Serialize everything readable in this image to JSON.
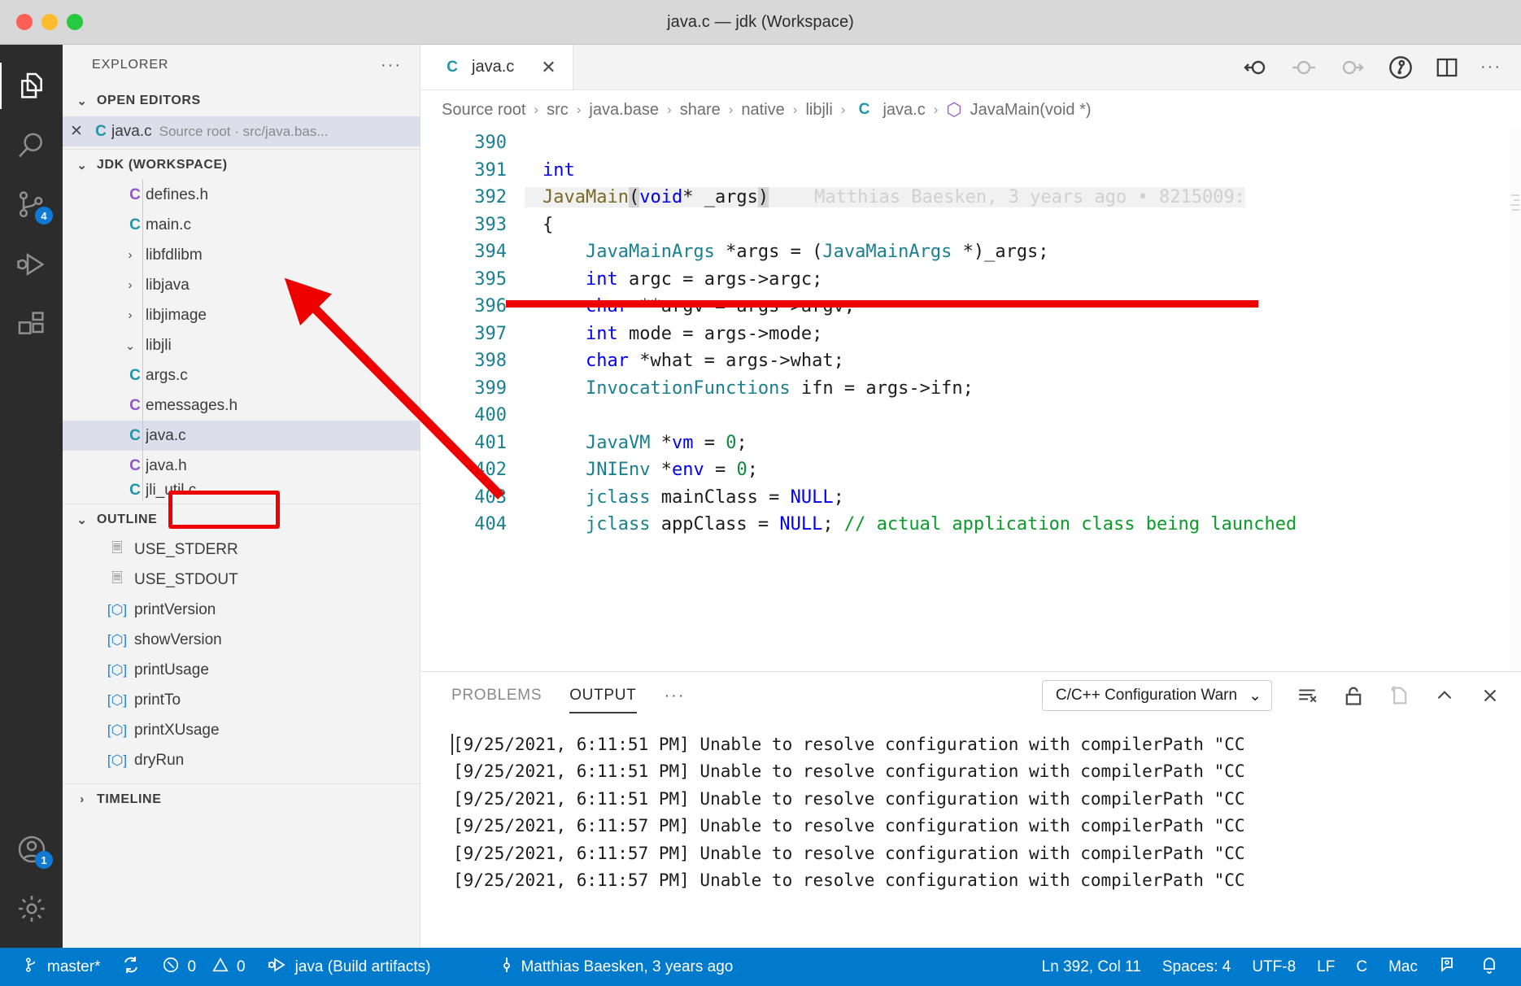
{
  "window": {
    "title": "java.c — jdk (Workspace)",
    "traffic_lights": [
      "close",
      "minimize",
      "zoom"
    ]
  },
  "activity_bar": {
    "items": [
      {
        "name": "explorer",
        "icon": "files-icon",
        "active": true,
        "badge": null
      },
      {
        "name": "search",
        "icon": "search-icon",
        "active": false,
        "badge": null
      },
      {
        "name": "source-control",
        "icon": "source-control-icon",
        "active": false,
        "badge": "4"
      },
      {
        "name": "run-and-debug",
        "icon": "run-debug-icon",
        "active": false,
        "badge": null
      },
      {
        "name": "extensions",
        "icon": "extensions-icon",
        "active": false,
        "badge": null
      }
    ],
    "bottom_items": [
      {
        "name": "accounts",
        "icon": "account-icon",
        "badge": "1"
      },
      {
        "name": "manage",
        "icon": "gear-icon",
        "badge": null
      }
    ]
  },
  "sidebar": {
    "title": "EXPLORER",
    "more_actions": "···",
    "open_editors": {
      "label": "OPEN EDITORS",
      "expanded": true,
      "items": [
        {
          "close": "✕",
          "icon": "c-file-icon",
          "icon_kind": "c",
          "name": "java.c",
          "description": "Source root · src/java.bas...",
          "selected": true
        }
      ]
    },
    "workspace": {
      "label": "JDK (WORKSPACE)",
      "expanded": true,
      "items": [
        {
          "name": "defines.h",
          "kind": "file",
          "icon_kind": "h",
          "depth": 2,
          "selected": false
        },
        {
          "name": "main.c",
          "kind": "file",
          "icon_kind": "c",
          "depth": 2,
          "selected": false
        },
        {
          "name": "libfdlibm",
          "kind": "folder",
          "twisty": "›",
          "depth": 1,
          "selected": false
        },
        {
          "name": "libjava",
          "kind": "folder",
          "twisty": "›",
          "depth": 1,
          "selected": false
        },
        {
          "name": "libjimage",
          "kind": "folder",
          "twisty": "›",
          "depth": 1,
          "selected": false
        },
        {
          "name": "libjli",
          "kind": "folder",
          "twisty": "⌄",
          "depth": 1,
          "selected": false
        },
        {
          "name": "args.c",
          "kind": "file",
          "icon_kind": "c",
          "depth": 2,
          "selected": false
        },
        {
          "name": "emessages.h",
          "kind": "file",
          "icon_kind": "h",
          "depth": 2,
          "selected": false
        },
        {
          "name": "java.c",
          "kind": "file",
          "icon_kind": "c",
          "depth": 2,
          "selected": true
        },
        {
          "name": "java.h",
          "kind": "file",
          "icon_kind": "h",
          "depth": 2,
          "selected": false
        },
        {
          "name": "jli_util.c",
          "kind": "file",
          "icon_kind": "c",
          "depth": 2,
          "selected": false
        }
      ]
    },
    "outline": {
      "label": "OUTLINE",
      "expanded": true,
      "items": [
        {
          "name": "USE_STDERR",
          "icon": "field-icon",
          "kind": "field"
        },
        {
          "name": "USE_STDOUT",
          "icon": "field-icon",
          "kind": "field"
        },
        {
          "name": "printVersion",
          "icon": "function-icon",
          "kind": "function"
        },
        {
          "name": "showVersion",
          "icon": "function-icon",
          "kind": "function"
        },
        {
          "name": "printUsage",
          "icon": "function-icon",
          "kind": "function"
        },
        {
          "name": "printTo",
          "icon": "function-icon",
          "kind": "function"
        },
        {
          "name": "printXUsage",
          "icon": "function-icon",
          "kind": "function"
        },
        {
          "name": "dryRun",
          "icon": "function-icon",
          "kind": "function"
        }
      ]
    },
    "timeline": {
      "label": "TIMELINE",
      "expanded": false
    }
  },
  "editor": {
    "tab": {
      "icon": "c-file-icon",
      "label": "java.c",
      "close": "✕",
      "active": true
    },
    "actions": [
      {
        "name": "previous-change-icon",
        "state": "enabled"
      },
      {
        "name": "current-change-icon",
        "state": "disabled"
      },
      {
        "name": "next-change-icon",
        "state": "disabled"
      },
      {
        "name": "git-timeline-icon",
        "state": "enabled"
      },
      {
        "name": "split-editor-icon",
        "state": "enabled"
      },
      {
        "name": "more-actions-icon",
        "state": "enabled"
      }
    ],
    "breadcrumb": [
      {
        "label": "Source root",
        "icon": null
      },
      {
        "label": "src",
        "icon": null
      },
      {
        "label": "java.base",
        "icon": null
      },
      {
        "label": "share",
        "icon": null
      },
      {
        "label": "native",
        "icon": null
      },
      {
        "label": "libjli",
        "icon": null
      },
      {
        "label": "java.c",
        "icon": "c-file-icon"
      },
      {
        "label": "JavaMain(void *)",
        "icon": "symbol-function-icon"
      }
    ],
    "breadcrumb_separator": "›",
    "blame_annotation": "Matthias Baesken, 3 years ago • 8215009:",
    "breakpoint_line": 394,
    "lines": [
      {
        "n": "390",
        "tokens": []
      },
      {
        "n": "391",
        "tokens": [
          {
            "t": "int",
            "c": "kw"
          }
        ]
      },
      {
        "n": "392",
        "current": true,
        "tokens": [
          {
            "t": "JavaMain",
            "c": "fn"
          },
          {
            "t": "(",
            "c": "brk"
          },
          {
            "t": "void",
            "c": "kw"
          },
          {
            "t": "* _args",
            "c": "txt"
          },
          {
            "t": ")",
            "c": "brk"
          }
        ]
      },
      {
        "n": "393",
        "tokens": [
          {
            "t": "{",
            "c": "txt"
          }
        ]
      },
      {
        "n": "394",
        "tokens": [
          {
            "t": "    ",
            "c": "txt"
          },
          {
            "t": "JavaMainArgs",
            "c": "type"
          },
          {
            "t": " *args = (",
            "c": "txt"
          },
          {
            "t": "JavaMainArgs",
            "c": "type"
          },
          {
            "t": " *)_args;",
            "c": "txt"
          }
        ]
      },
      {
        "n": "395",
        "tokens": [
          {
            "t": "    ",
            "c": "txt"
          },
          {
            "t": "int",
            "c": "kw"
          },
          {
            "t": " argc = args->argc;",
            "c": "txt"
          }
        ]
      },
      {
        "n": "396",
        "tokens": [
          {
            "t": "    ",
            "c": "txt"
          },
          {
            "t": "char",
            "c": "kw"
          },
          {
            "t": " **argv = args->argv;",
            "c": "txt"
          }
        ]
      },
      {
        "n": "397",
        "tokens": [
          {
            "t": "    ",
            "c": "txt"
          },
          {
            "t": "int",
            "c": "kw"
          },
          {
            "t": " mode = args->mode;",
            "c": "txt"
          }
        ]
      },
      {
        "n": "398",
        "tokens": [
          {
            "t": "    ",
            "c": "txt"
          },
          {
            "t": "char",
            "c": "kw"
          },
          {
            "t": " *what = args->what;",
            "c": "txt"
          }
        ]
      },
      {
        "n": "399",
        "tokens": [
          {
            "t": "    ",
            "c": "txt"
          },
          {
            "t": "InvocationFunctions",
            "c": "type"
          },
          {
            "t": " ifn = args->ifn;",
            "c": "txt"
          }
        ]
      },
      {
        "n": "400",
        "tokens": []
      },
      {
        "n": "401",
        "tokens": [
          {
            "t": "    ",
            "c": "txt"
          },
          {
            "t": "JavaVM",
            "c": "type"
          },
          {
            "t": " *",
            "c": "txt"
          },
          {
            "t": "vm",
            "c": "kw"
          },
          {
            "t": " = ",
            "c": "txt"
          },
          {
            "t": "0",
            "c": "num"
          },
          {
            "t": ";",
            "c": "txt"
          }
        ]
      },
      {
        "n": "402",
        "tokens": [
          {
            "t": "    ",
            "c": "txt"
          },
          {
            "t": "JNIEnv",
            "c": "type"
          },
          {
            "t": " *",
            "c": "txt"
          },
          {
            "t": "env",
            "c": "kw"
          },
          {
            "t": " = ",
            "c": "txt"
          },
          {
            "t": "0",
            "c": "num"
          },
          {
            "t": ";",
            "c": "txt"
          }
        ]
      },
      {
        "n": "403",
        "tokens": [
          {
            "t": "    ",
            "c": "txt"
          },
          {
            "t": "jclass",
            "c": "type"
          },
          {
            "t": " mainClass = ",
            "c": "txt"
          },
          {
            "t": "NULL",
            "c": "kw"
          },
          {
            "t": ";",
            "c": "txt"
          }
        ]
      },
      {
        "n": "404",
        "tokens": [
          {
            "t": "    ",
            "c": "txt"
          },
          {
            "t": "jclass",
            "c": "type"
          },
          {
            "t": " appClass = ",
            "c": "txt"
          },
          {
            "t": "NULL",
            "c": "kw"
          },
          {
            "t": "; ",
            "c": "txt"
          },
          {
            "t": "// actual application class being launched",
            "c": "cmt"
          }
        ]
      }
    ]
  },
  "panel": {
    "tabs": [
      {
        "label": "PROBLEMS",
        "active": false
      },
      {
        "label": "OUTPUT",
        "active": true
      }
    ],
    "more_tabs": "···",
    "channel_select": {
      "value": "C/C++ Configuration Warn",
      "chevron": "⌄"
    },
    "actions": [
      {
        "name": "clear-output-icon",
        "state": "enabled"
      },
      {
        "name": "scroll-lock-icon",
        "state": "enabled"
      },
      {
        "name": "open-in-editor-icon",
        "state": "disabled"
      },
      {
        "name": "collapse-panel-icon",
        "state": "enabled"
      },
      {
        "name": "close-panel-icon",
        "state": "enabled"
      }
    ],
    "output_lines": [
      "[9/25/2021, 6:11:51 PM] Unable to resolve configuration with compilerPath \"CC",
      "[9/25/2021, 6:11:51 PM] Unable to resolve configuration with compilerPath \"CC",
      "[9/25/2021, 6:11:51 PM] Unable to resolve configuration with compilerPath \"CC",
      "[9/25/2021, 6:11:57 PM] Unable to resolve configuration with compilerPath \"CC",
      "[9/25/2021, 6:11:57 PM] Unable to resolve configuration with compilerPath \"CC",
      "[9/25/2021, 6:11:57 PM] Unable to resolve configuration with compilerPath \"CC"
    ]
  },
  "status_bar": {
    "background": "#007acc",
    "left": [
      {
        "name": "git-branch",
        "icon": "source-control-icon",
        "label": "master*"
      },
      {
        "name": "sync-changes",
        "icon": "sync-icon",
        "label": ""
      },
      {
        "name": "problems",
        "icon": "error-warning-icon",
        "label": "0 0",
        "errors": "0",
        "warnings": "0"
      },
      {
        "name": "build-target",
        "icon": "debug-launch-icon",
        "label": "java (Build artifacts)"
      },
      {
        "name": "git-blame",
        "icon": "git-commit-icon",
        "label": "Matthias Baesken, 3 years ago"
      }
    ],
    "right": [
      {
        "name": "cursor-position",
        "label": "Ln 392, Col 11"
      },
      {
        "name": "indentation",
        "label": "Spaces: 4"
      },
      {
        "name": "encoding",
        "label": "UTF-8"
      },
      {
        "name": "eol",
        "label": "LF"
      },
      {
        "name": "language-mode",
        "label": "C"
      },
      {
        "name": "cpp-config",
        "label": "Mac"
      },
      {
        "name": "live-share",
        "icon": "live-share-icon",
        "label": ""
      },
      {
        "name": "notifications",
        "icon": "bell-icon",
        "label": ""
      }
    ]
  },
  "annotations": {
    "highlight_box_target": "java.c",
    "underline_target": "line-394",
    "arrow_color": "#ee0000"
  }
}
